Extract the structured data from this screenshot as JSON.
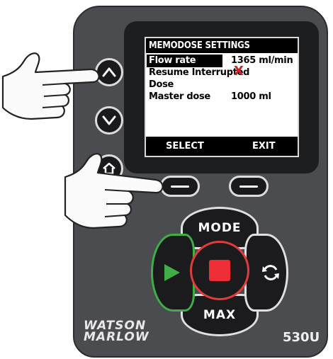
{
  "screen": {
    "title": "MEMODOSE SETTINGS",
    "rows": [
      {
        "label": "Flow rate",
        "value": "1365 ml/min",
        "selected": true
      },
      {
        "label": "Resume Interrupted",
        "value": "X"
      },
      {
        "label": "Dose",
        "value": ""
      },
      {
        "label": "Master dose",
        "value": "1000 ml"
      }
    ],
    "softkeys": {
      "left": "SELECT",
      "right": "EXIT"
    }
  },
  "keypad": {
    "mode": "MODE",
    "max": "MAX"
  },
  "branding": {
    "line1": "WATSON",
    "line2": "MARLOW",
    "model": "530U"
  },
  "colors": {
    "body": "#4a4c50",
    "start_green": "#3fae48",
    "stop_red": "#ee2d36",
    "selection": "#000000"
  }
}
